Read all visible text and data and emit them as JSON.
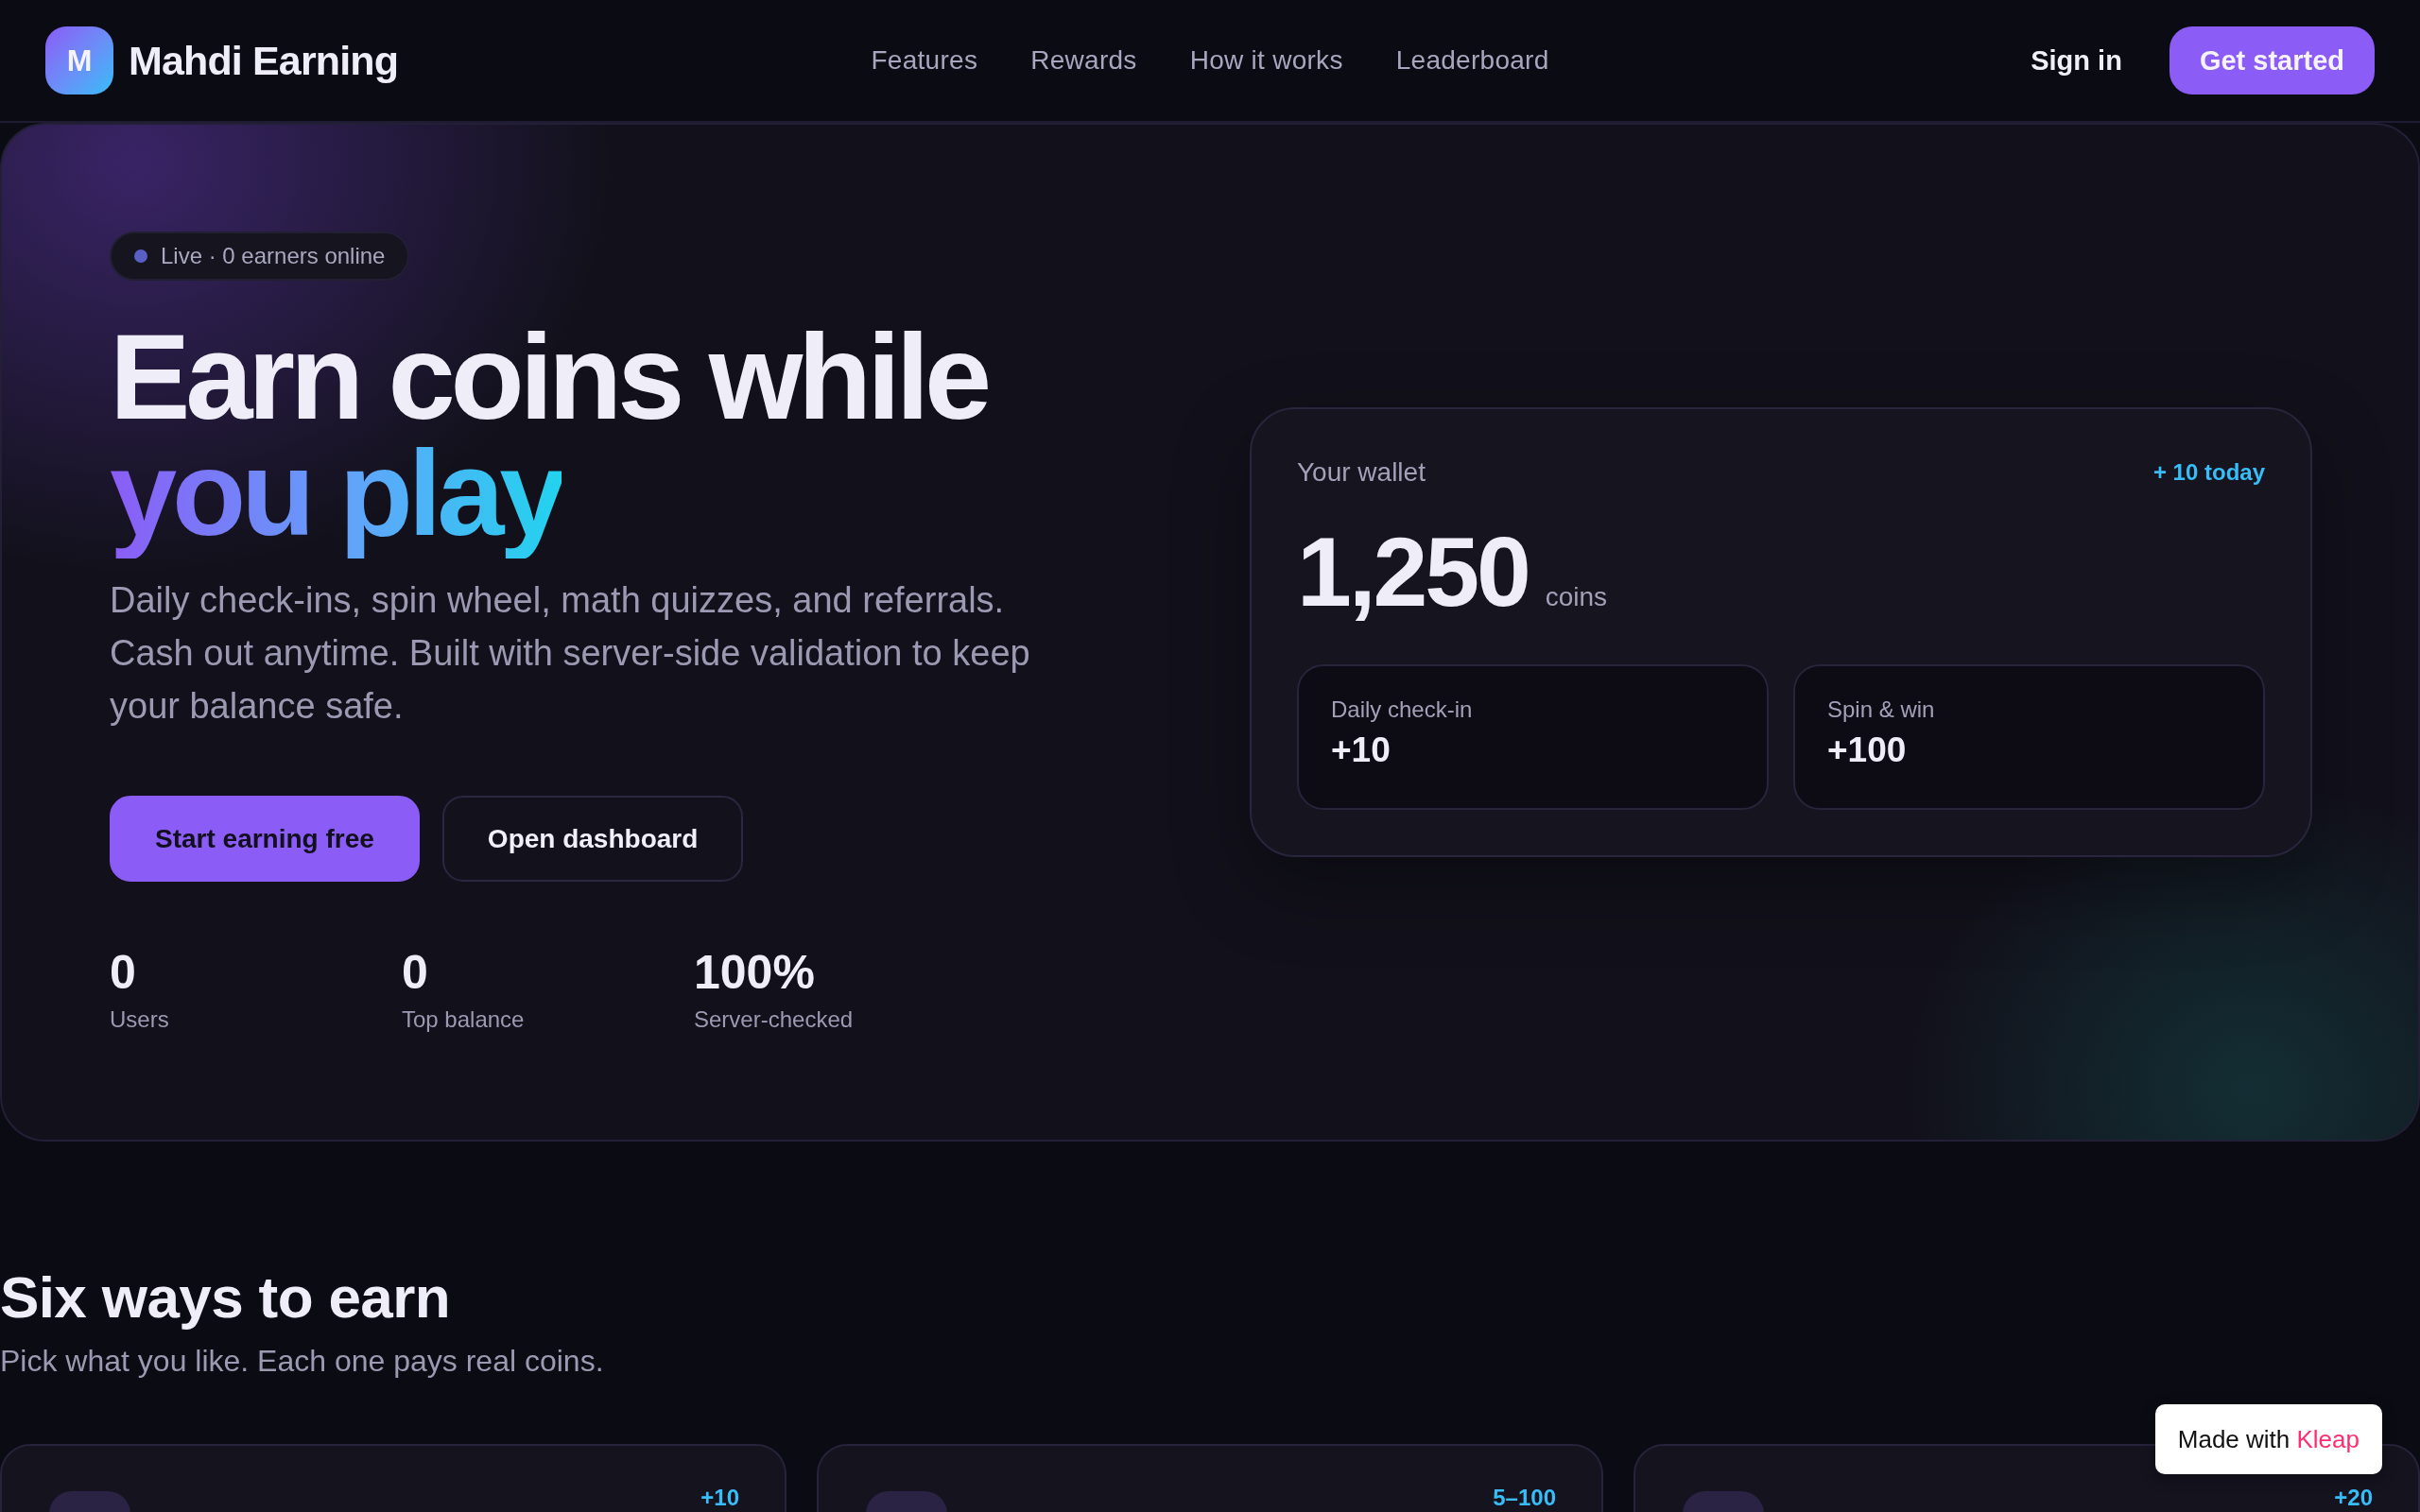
{
  "header": {
    "brand": {
      "logo_letter": "M",
      "name": "Mahdi Earning"
    },
    "nav_links": [
      "Features",
      "Rewards",
      "How it works",
      "Leaderboard"
    ],
    "actions": [
      {
        "label": "Sign in",
        "kind": "link"
      },
      {
        "label": "Get started",
        "kind": "primary"
      }
    ]
  },
  "hero": {
    "live_badge": "Live · 0 earners online",
    "headline": {
      "line_1": "Earn coins while",
      "highlight": "you play"
    },
    "description": "Daily check-ins, spin wheel, math quizzes, and referrals. Cash out anytime. Built with server-side validation to keep your balance safe.",
    "buttons": [
      {
        "label": "Start earning free",
        "kind": "primary"
      },
      {
        "label": "Open dashboard",
        "kind": "outline"
      }
    ],
    "stats": [
      {
        "value": "0",
        "label": "Users"
      },
      {
        "value": "0",
        "label": "Top balance"
      },
      {
        "value": "100%",
        "label": "Server-checked"
      }
    ],
    "wallet": {
      "title": "Your wallet",
      "today": "+ 10 today",
      "balance": "1,250",
      "unit": "coins",
      "rewards": [
        {
          "label": "Daily check-in",
          "value": "+10"
        },
        {
          "label": "Spin & win",
          "value": "+100"
        }
      ]
    }
  },
  "earn_section": {
    "title": "Six ways to earn",
    "subtitle": "Pick what you like. Each one pays real coins.",
    "cards": [
      {
        "reward": "+10"
      },
      {
        "reward": "5–100"
      },
      {
        "reward": "+20"
      }
    ]
  },
  "made_with_badge": {
    "label": "Made with",
    "brand": "Kleap"
  }
}
